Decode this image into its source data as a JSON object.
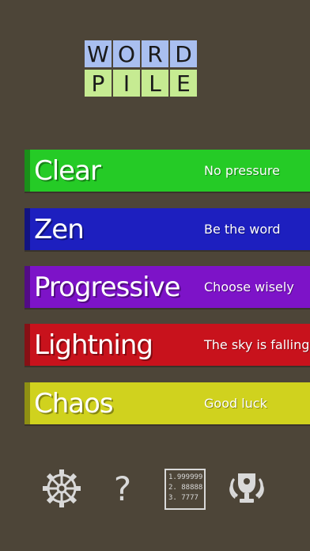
{
  "logo": {
    "row1": [
      "W",
      "O",
      "R",
      "D"
    ],
    "row2": [
      "P",
      "I",
      "L",
      "E"
    ]
  },
  "modes": [
    {
      "name": "Clear",
      "tagline": "No pressure",
      "color": "#25cb26",
      "edge": "#1a8f1a"
    },
    {
      "name": "Zen",
      "tagline": "Be the word",
      "color": "#1d1fbf",
      "edge": "#121380"
    },
    {
      "name": "Progressive",
      "tagline": "Choose wisely",
      "color": "#7d13c8",
      "edge": "#520c85"
    },
    {
      "name": "Lightning",
      "tagline": "The sky is falling",
      "color": "#c8121c",
      "edge": "#861015"
    },
    {
      "name": "Chaos",
      "tagline": "Good luck",
      "color": "#d0d21e",
      "edge": "#8e8f13"
    }
  ],
  "toolbar": {
    "help_label": "?",
    "scores": [
      "1.999999",
      "2. 88888",
      "3. 7777"
    ],
    "icons": [
      "gear-icon",
      "help-icon",
      "scoreboard-icon",
      "trophy-icon"
    ]
  }
}
